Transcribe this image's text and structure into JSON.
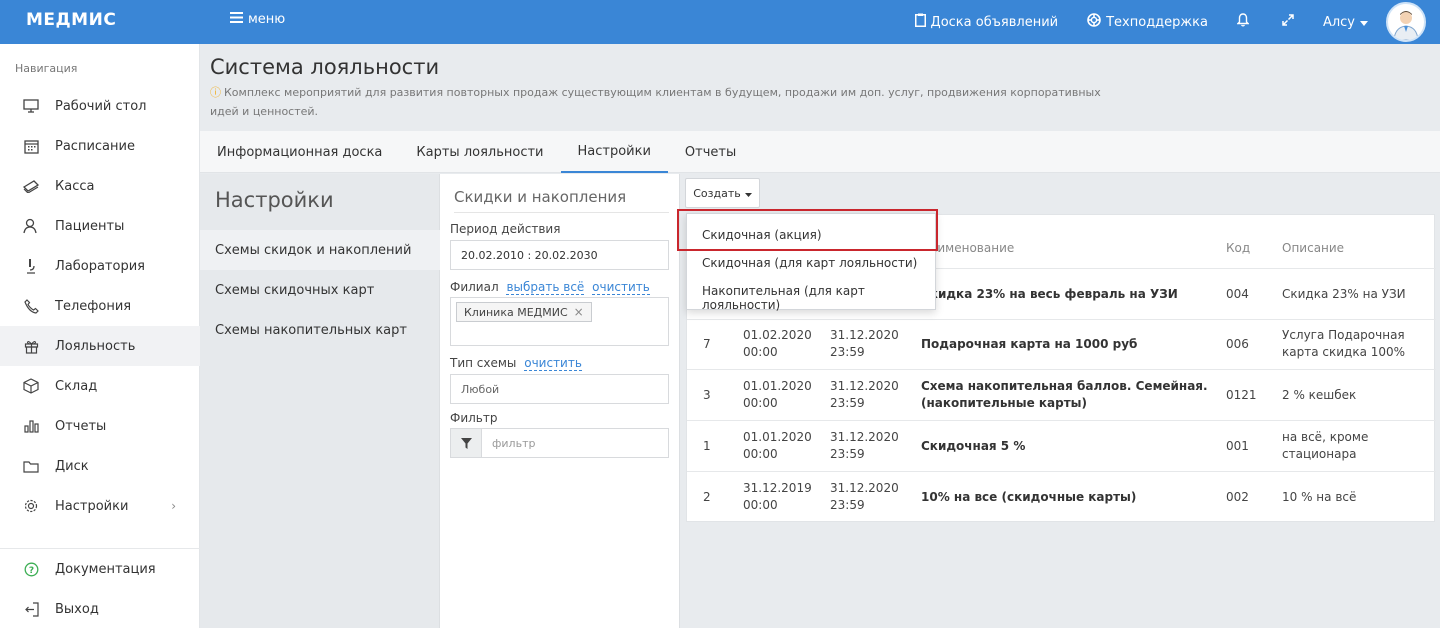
{
  "topbar": {
    "logo": "МЕДМИС",
    "menu_label": "меню",
    "board_label": "Доска объявлений",
    "support_label": "Техподдержка",
    "user_label": "Алсу",
    "accent_color": "#3a86d6"
  },
  "sidebar": {
    "heading": "Навигация",
    "items": [
      {
        "label": "Рабочий стол",
        "icon": "desktop-icon"
      },
      {
        "label": "Расписание",
        "icon": "calendar-icon"
      },
      {
        "label": "Касса",
        "icon": "cash-icon"
      },
      {
        "label": "Пациенты",
        "icon": "patients-icon"
      },
      {
        "label": "Лаборатория",
        "icon": "microscope-icon"
      },
      {
        "label": "Телефония",
        "icon": "phone-icon"
      },
      {
        "label": "Лояльность",
        "icon": "gift-icon"
      },
      {
        "label": "Склад",
        "icon": "box-icon"
      },
      {
        "label": "Отчеты",
        "icon": "chart-icon"
      },
      {
        "label": "Диск",
        "icon": "folder-icon"
      },
      {
        "label": "Настройки",
        "icon": "gear-icon"
      }
    ],
    "bottom": [
      {
        "label": "Документация",
        "icon": "help-icon"
      },
      {
        "label": "Выход",
        "icon": "logout-icon"
      }
    ]
  },
  "page": {
    "title": "Система лояльности",
    "description": "Комплекс мероприятий для развития повторных продаж существующим клиентам в будущем, продажи им доп. услуг, продвижения корпоративных идей и ценностей."
  },
  "tabs": [
    "Информационная доска",
    "Карты лояльности",
    "Настройки",
    "Отчеты"
  ],
  "settings": {
    "title": "Настройки",
    "links": [
      "Схемы скидок и накоплений",
      "Схемы скидочных карт",
      "Схемы накопительных карт"
    ]
  },
  "filters": {
    "heading": "Скидки и накопления",
    "period_label": "Период действия",
    "period_value": "20.02.2010 : 20.02.2030",
    "branch_label": "Филиал",
    "select_all": "выбрать всё",
    "clear": "очистить",
    "branch_tag": "Клиника МЕДМИС",
    "scheme_type_label": "Тип схемы",
    "scheme_type_value": "Любой",
    "filter_label": "Фильтр",
    "filter_placeholder": "фильтр"
  },
  "create_button": "Создать",
  "dropdown": [
    "Скидочная (акция)",
    "Скидочная (для карт лояльности)",
    "Накопительная (для карт лояльности)"
  ],
  "table": {
    "headers": {
      "name": "Наименование",
      "code": "Код",
      "desc": "Описание"
    },
    "rows": [
      {
        "id": "",
        "start_date": "",
        "start_time": "",
        "end_date": "",
        "end_time": "",
        "name": "Скидка 23% на весь февраль на УЗИ",
        "code": "004",
        "desc": "Скидка 23% на УЗИ"
      },
      {
        "id": "7",
        "start_date": "01.02.2020",
        "start_time": "00:00",
        "end_date": "31.12.2020",
        "end_time": "23:59",
        "name": "Подарочная карта на 1000 руб",
        "code": "006",
        "desc": "Услуга Подарочная карта скидка 100%"
      },
      {
        "id": "3",
        "start_date": "01.01.2020",
        "start_time": "00:00",
        "end_date": "31.12.2020",
        "end_time": "23:59",
        "name": "Схема накопительная баллов. Семейная. (накопительные карты)",
        "code": "0121",
        "desc": "2 % кешбек"
      },
      {
        "id": "1",
        "start_date": "01.01.2020",
        "start_time": "00:00",
        "end_date": "31.12.2020",
        "end_time": "23:59",
        "name": "Скидочная 5 %",
        "code": "001",
        "desc": "на всё, кроме стационара"
      },
      {
        "id": "2",
        "start_date": "31.12.2019",
        "start_time": "00:00",
        "end_date": "31.12.2020",
        "end_time": "23:59",
        "name": "10% на все (скидочные карты)",
        "code": "002",
        "desc": "10 % на всё"
      }
    ]
  }
}
